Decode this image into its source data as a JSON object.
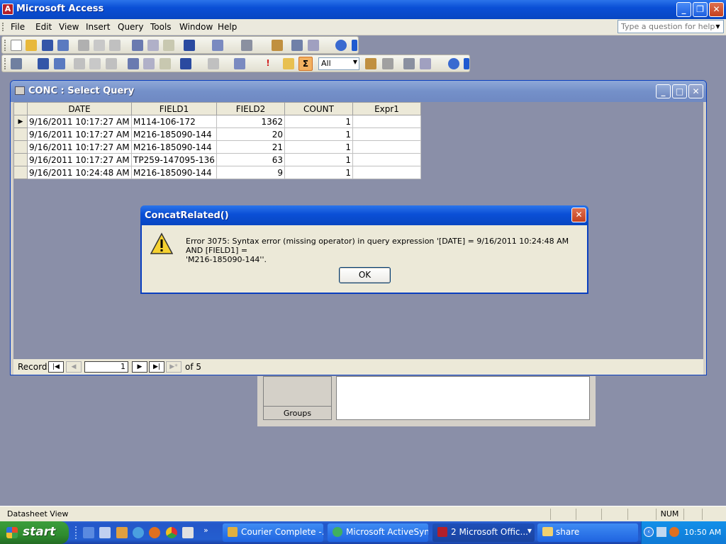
{
  "app": {
    "title": "Microsoft Access",
    "icon_letter": "A"
  },
  "menu": {
    "items": [
      "File",
      "Edit",
      "View",
      "Insert",
      "Query",
      "Tools",
      "Window",
      "Help"
    ],
    "help_placeholder": "Type a question for help"
  },
  "toolbar2": {
    "top_values": "All"
  },
  "query_window": {
    "title": "CONC : Select Query",
    "columns": [
      "DATE",
      "FIELD1",
      "FIELD2",
      "COUNT",
      "Expr1"
    ],
    "rows": [
      [
        "9/16/2011 10:17:27 AM",
        "M114-106-172",
        "1362",
        "1",
        ""
      ],
      [
        "9/16/2011 10:17:27 AM",
        "M216-185090-144",
        "20",
        "1",
        ""
      ],
      [
        "9/16/2011 10:17:27 AM",
        "M216-185090-144",
        "21",
        "1",
        ""
      ],
      [
        "9/16/2011 10:17:27 AM",
        "TP259-147095-136",
        "63",
        "1",
        ""
      ],
      [
        "9/16/2011 10:24:48 AM",
        "M216-185090-144",
        "9",
        "1",
        ""
      ]
    ],
    "record_label": "Record:",
    "record_current": "1",
    "record_of": "of  5"
  },
  "behind_window": {
    "groups_label": "Groups"
  },
  "dialog": {
    "title": "ConcatRelated()",
    "message_line1": "Error 3075: Syntax error (missing operator) in query expression '[DATE] = 9/16/2011 10:24:48 AM AND [FIELD1] =",
    "message_line2": "'M216-185090-144''.",
    "ok_label": "OK"
  },
  "statusbar": {
    "text": "Datasheet View",
    "num": "NUM"
  },
  "taskbar": {
    "start_label": "start",
    "tasks": [
      "Courier Complete -...",
      "Microsoft ActiveSync",
      "2 Microsoft Offic...",
      "share"
    ],
    "clock": "10:50 AM"
  },
  "colors": {
    "title_blue": "#0a4fd6",
    "mdi_bg": "#8a8fa8",
    "face": "#ece9d8",
    "start_green": "#2f8c2f"
  }
}
